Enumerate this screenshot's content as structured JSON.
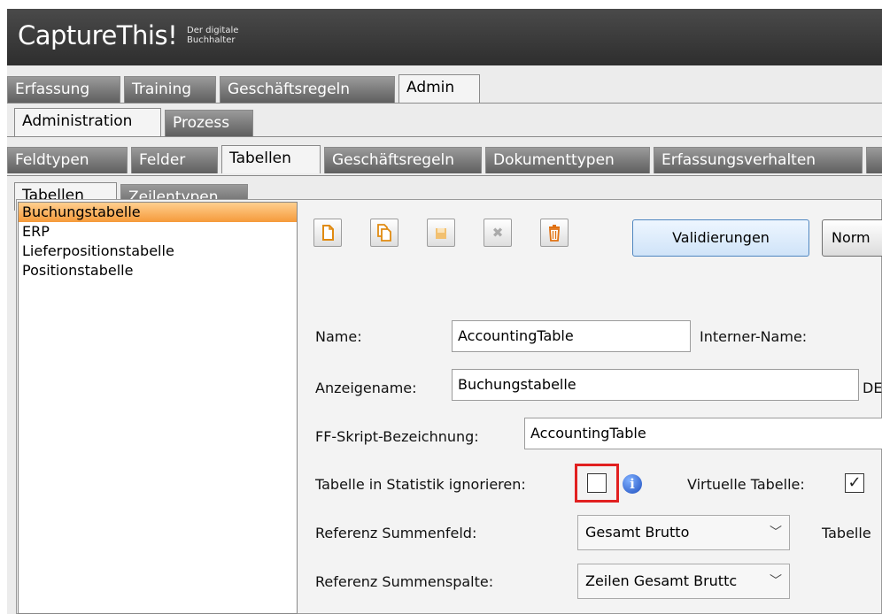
{
  "app": {
    "title": "CaptureThis!",
    "tagline": "Der digitale Buchhalter"
  },
  "main_tabs": [
    {
      "label": "Erfassung",
      "active": false
    },
    {
      "label": "Training",
      "active": false
    },
    {
      "label": "Geschäftsregeln",
      "active": false
    },
    {
      "label": "Admin",
      "active": true
    }
  ],
  "admin_tabs": [
    {
      "label": "Administration",
      "active": true
    },
    {
      "label": "Prozess",
      "active": false
    }
  ],
  "section_tabs": [
    {
      "label": "Feldtypen",
      "active": false
    },
    {
      "label": "Felder",
      "active": false
    },
    {
      "label": "Tabellen",
      "active": true
    },
    {
      "label": "Geschäftsregeln",
      "active": false
    },
    {
      "label": "Dokumenttypen",
      "active": false
    },
    {
      "label": "Erfassungsverhalten",
      "active": false
    }
  ],
  "table_tabs": [
    {
      "label": "Tabellen",
      "active": true
    },
    {
      "label": "Zeilentypen",
      "active": false
    }
  ],
  "table_list": [
    {
      "label": "Buchungstabelle",
      "selected": true
    },
    {
      "label": "ERP",
      "selected": false
    },
    {
      "label": "Lieferpositionstabelle",
      "selected": false
    },
    {
      "label": "Positionstabelle",
      "selected": false
    }
  ],
  "toolbar": {
    "icons": [
      "new-document-icon",
      "copy-document-icon",
      "save-icon",
      "cancel-icon",
      "delete-trash-icon"
    ],
    "validate_button": "Validierungen",
    "normal_button": "Norm"
  },
  "form": {
    "name_label": "Name:",
    "name_value": "AccountingTable",
    "internal_name_label": "Interner-Name:",
    "display_name_label": "Anzeigename:",
    "display_name_value": "Buchungstabelle",
    "language_code": "DE",
    "ff_script_label": "FF-Skript-Bezeichnung:",
    "ff_script_value": "AccountingTable",
    "ignore_stats_label": "Tabelle in Statistik ignorieren:",
    "ignore_stats_checked": false,
    "virtual_table_label": "Virtuelle Tabelle:",
    "virtual_table_checked": true,
    "ref_sum_field_label": "Referenz Summenfeld:",
    "ref_sum_field_value": "Gesamt Brutto",
    "table_label_cut": "Tabelle",
    "ref_sum_column_label": "Referenz Summenspalte:",
    "ref_sum_column_value": "Zeilen Gesamt Bruttc"
  },
  "colors": {
    "highlight": "#e12020",
    "selection": "#f59a3a",
    "titlebar": "#3a3a3a"
  }
}
